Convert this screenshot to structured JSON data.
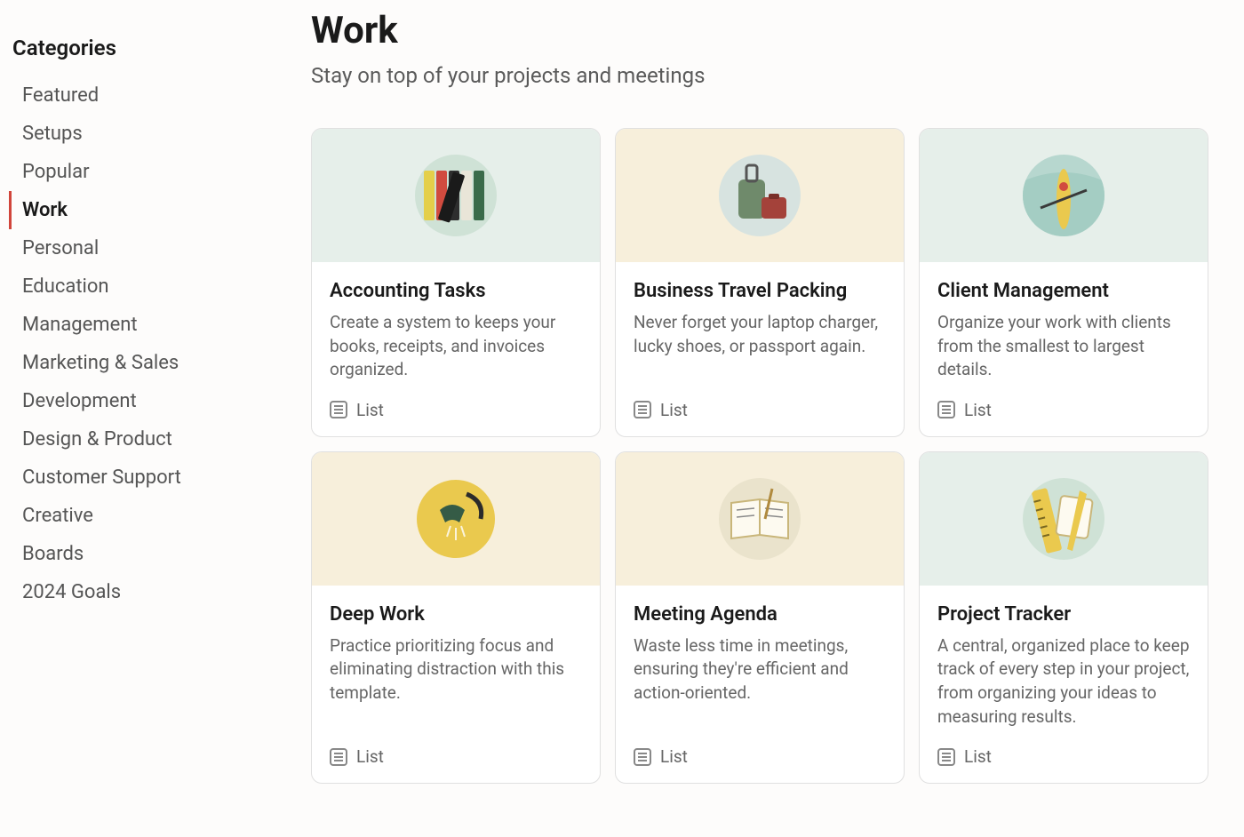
{
  "sidebar": {
    "title": "Categories",
    "items": [
      {
        "label": "Featured",
        "active": false
      },
      {
        "label": "Setups",
        "active": false
      },
      {
        "label": "Popular",
        "active": false
      },
      {
        "label": "Work",
        "active": true
      },
      {
        "label": "Personal",
        "active": false
      },
      {
        "label": "Education",
        "active": false
      },
      {
        "label": "Management",
        "active": false
      },
      {
        "label": "Marketing & Sales",
        "active": false
      },
      {
        "label": "Development",
        "active": false
      },
      {
        "label": "Design & Product",
        "active": false
      },
      {
        "label": "Customer Support",
        "active": false
      },
      {
        "label": "Creative",
        "active": false
      },
      {
        "label": "Boards",
        "active": false
      },
      {
        "label": "2024 Goals",
        "active": false
      }
    ]
  },
  "page": {
    "title": "Work",
    "subtitle": "Stay on top of your projects and meetings"
  },
  "templates": [
    {
      "title": "Accounting Tasks",
      "desc": "Create a system to keeps your books, receipts, and invoices organized.",
      "type": "List",
      "cover": "green",
      "icon": "binders"
    },
    {
      "title": "Business Travel Packing",
      "desc": "Never forget your laptop charger, lucky shoes, or passport again.",
      "type": "List",
      "cover": "cream",
      "icon": "luggage"
    },
    {
      "title": "Client Management",
      "desc": "Organize your work with clients from the smallest to largest details.",
      "type": "List",
      "cover": "green",
      "icon": "rower"
    },
    {
      "title": "Deep Work",
      "desc": "Practice prioritizing focus and eliminating distraction with this template.",
      "type": "List",
      "cover": "cream",
      "icon": "lamp"
    },
    {
      "title": "Meeting Agenda",
      "desc": "Waste less time in meetings, ensuring they're efficient and action-oriented.",
      "type": "List",
      "cover": "cream",
      "icon": "notebook"
    },
    {
      "title": "Project Tracker",
      "desc": "A central, organized place to keep track of every step in your project, from organizing your ideas to measuring results.",
      "type": "List",
      "cover": "green",
      "icon": "ruler"
    }
  ]
}
